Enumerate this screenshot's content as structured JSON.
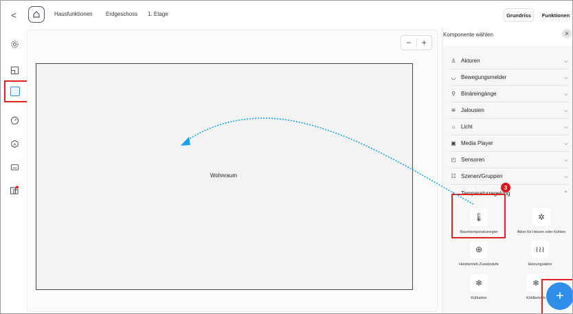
{
  "topbar": {
    "back": "<",
    "breadcrumbs": [
      "Hausfunktionen",
      "Erdgeschoss",
      "1. Etage"
    ],
    "segment_left": "Grundriss",
    "segment_right": "Funktionen"
  },
  "canvas": {
    "zoom_minus": "−",
    "zoom_plus": "+",
    "room_label": "Wohnraum"
  },
  "panel": {
    "title": "Komponente wählen",
    "close": "✕",
    "categories": [
      {
        "label": "Aktoren",
        "icon": "actuator-icon"
      },
      {
        "label": "Bewegungsmelder",
        "icon": "motion-sensor-icon"
      },
      {
        "label": "Binäreingänge",
        "icon": "binary-input-icon"
      },
      {
        "label": "Jalousien",
        "icon": "blinds-icon"
      },
      {
        "label": "Licht",
        "icon": "light-icon"
      },
      {
        "label": "Media Player",
        "icon": "media-player-icon"
      },
      {
        "label": "Sensoren",
        "icon": "sensor-icon"
      },
      {
        "label": "Szenen/Gruppen",
        "icon": "scene-icon"
      },
      {
        "label": "Temperaturregelung",
        "icon": "thermostat-icon"
      }
    ],
    "tiles": [
      {
        "label": "Raumtemperaturregler",
        "icon": "thermometer-icon"
      },
      {
        "label": "Aktor für Heizen oder Kühlen",
        "icon": "heat-cool-icon"
      },
      {
        "label": "Heizbetrieb Zusatzstufe",
        "icon": "heating-extra-icon"
      },
      {
        "label": "Heizungsaktor",
        "icon": "heating-icon"
      },
      {
        "label": "Kühlaktor",
        "icon": "cooling-icon"
      },
      {
        "label": "Kühlbetrieb",
        "icon": "cooling-mode-icon"
      }
    ]
  },
  "badges": {
    "b1": "1",
    "b3": "3"
  },
  "fab": {
    "label": "+"
  },
  "colors": {
    "accent": "#2f8ee8",
    "highlight": "#e02020"
  }
}
